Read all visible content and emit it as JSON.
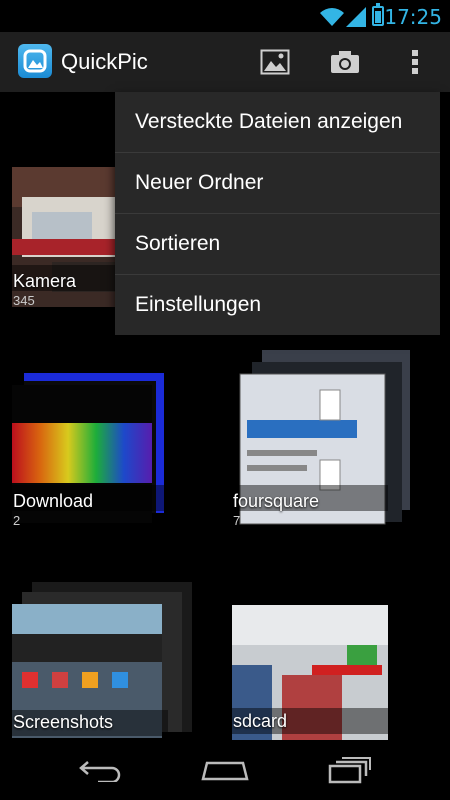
{
  "status": {
    "time": "17:25"
  },
  "app": {
    "title": "QuickPic"
  },
  "actionbar": {
    "icons": [
      "image-icon",
      "camera-icon",
      "overflow-menu-icon"
    ]
  },
  "menu": {
    "items": [
      {
        "label": "Versteckte Dateien anzeigen"
      },
      {
        "label": "Neuer Ordner"
      },
      {
        "label": "Sortieren"
      },
      {
        "label": "Einstellungen"
      }
    ]
  },
  "albums": [
    {
      "name": "Kamera",
      "count": "345"
    },
    {
      "name": "Download",
      "count": "2"
    },
    {
      "name": "foursquare",
      "count": "7"
    },
    {
      "name": "Screenshots",
      "count": ""
    },
    {
      "name": "sdcard",
      "count": ""
    }
  ],
  "colors": {
    "accent": "#33b5e5",
    "actionbar": "#1f1f1f",
    "menu": "#282828"
  }
}
